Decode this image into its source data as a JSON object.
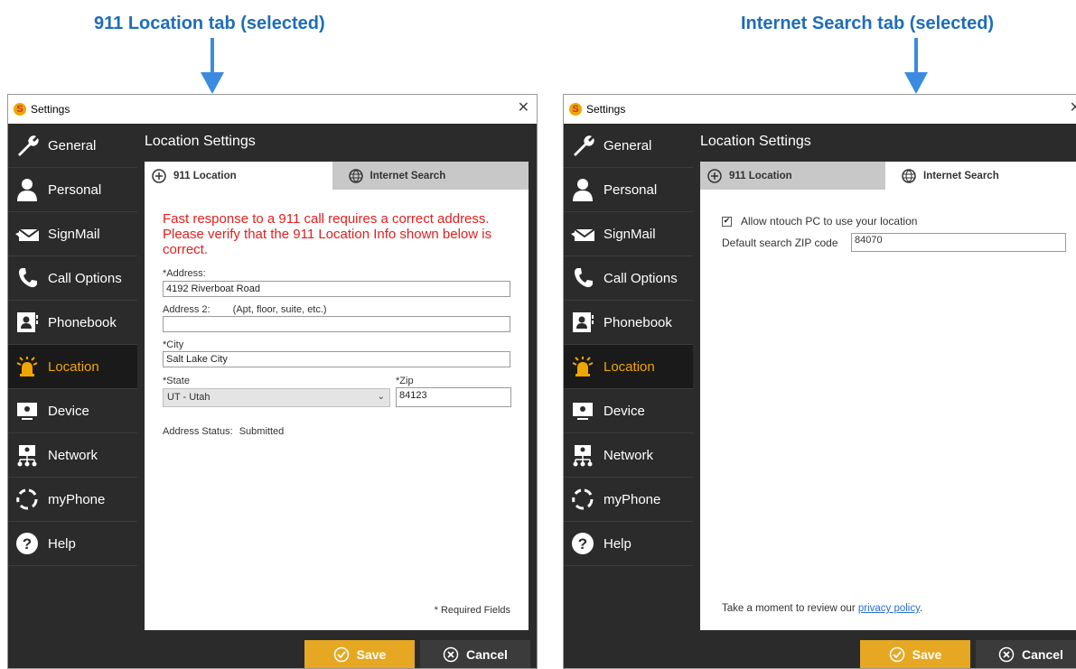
{
  "callouts": {
    "left": "911 Location tab (selected)",
    "right": "Internet Search tab (selected)"
  },
  "colors": {
    "callout_blue": "#1f6db8",
    "accent_orange": "#e6a823",
    "warning_red": "#e02020",
    "dark_bg": "#2b2b2b"
  },
  "windows": [
    {
      "title": "Settings",
      "section_title": "Location Settings",
      "tabs": [
        {
          "label": "911 Location",
          "icon": "plus-circle-icon",
          "selected": true
        },
        {
          "label": "Internet Search",
          "icon": "globe-icon",
          "selected": false
        }
      ]
    },
    {
      "title": "Settings",
      "section_title": "Location Settings",
      "tabs": [
        {
          "label": "911 Location",
          "icon": "plus-circle-icon",
          "selected": false
        },
        {
          "label": "Internet Search",
          "icon": "globe-icon",
          "selected": true
        }
      ]
    }
  ],
  "nav": [
    {
      "label": "General",
      "icon": "wrench-icon"
    },
    {
      "label": "Personal",
      "icon": "person-icon"
    },
    {
      "label": "SignMail",
      "icon": "signmail-icon"
    },
    {
      "label": "Call Options",
      "icon": "phone-handset-icon"
    },
    {
      "label": "Phonebook",
      "icon": "phonebook-icon"
    },
    {
      "label": "Location",
      "icon": "siren-icon",
      "active": true
    },
    {
      "label": "Device",
      "icon": "monitor-icon"
    },
    {
      "label": "Network",
      "icon": "network-icon"
    },
    {
      "label": "myPhone",
      "icon": "myphone-icon"
    },
    {
      "label": "Help",
      "icon": "help-icon"
    }
  ],
  "location_911": {
    "warning": "Fast response to a 911 call requires a correct address. Please verify that the 911 Location Info shown below is correct.",
    "address_label": "*Address:",
    "address_value": "4192 Riverboat Road",
    "address2_label": "Address 2:",
    "address2_hint": "(Apt, floor, suite, etc.)",
    "address2_value": "",
    "city_label": "*City",
    "city_value": "Salt Lake City",
    "state_label": "*State",
    "state_value": "UT  -  Utah",
    "zip_label": "*Zip",
    "zip_value": "84123",
    "status_label": "Address Status:",
    "status_value": "Submitted",
    "required_note": "* Required Fields"
  },
  "internet_search": {
    "allow_label": "Allow ntouch PC to use your location",
    "allow_checked": true,
    "zip_label": "Default search ZIP code",
    "zip_value": "84070",
    "privacy_prefix": "Take a moment to review our ",
    "privacy_link": "privacy policy",
    "privacy_suffix": "."
  },
  "buttons": {
    "save": "Save",
    "cancel": "Cancel"
  }
}
